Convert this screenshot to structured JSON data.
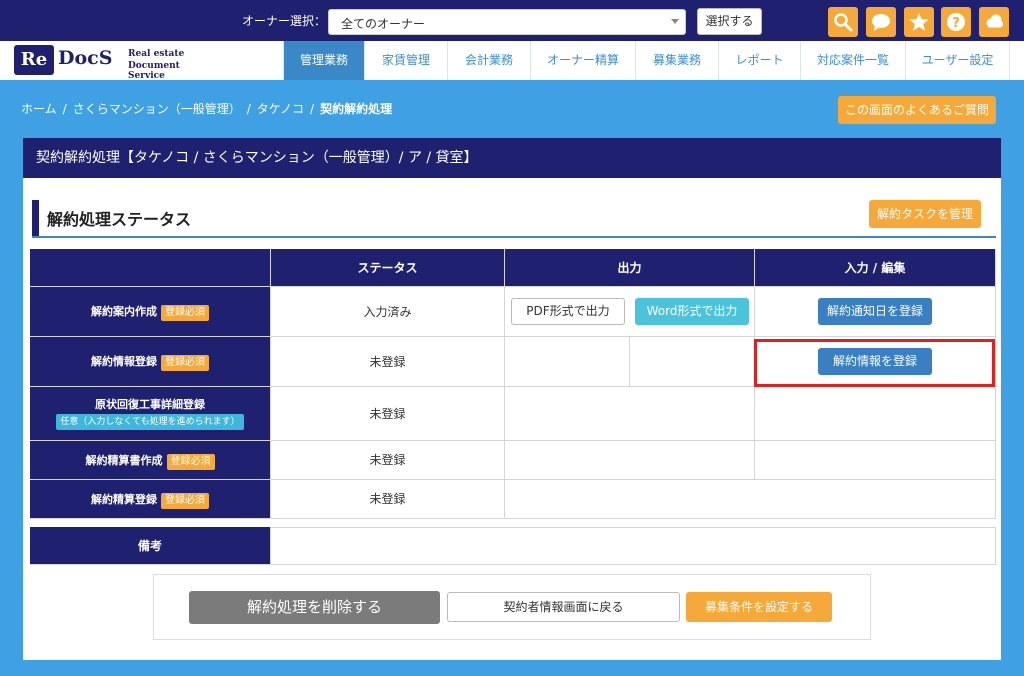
{
  "topbar": {
    "owner_label": "オーナー選択：",
    "owner_value": "全てのオーナー",
    "select_button": "選択する",
    "icons": [
      "search-icon",
      "chat-icon",
      "star-icon",
      "help-icon",
      "cloud-icon"
    ],
    "accent": "#f6a838",
    "bg": "#1f2170"
  },
  "logo": {
    "re": "Re",
    "docs": "DocS",
    "line1": "Real estate",
    "line2": "Document Service"
  },
  "nav": [
    {
      "label": "管理業務",
      "active": true
    },
    {
      "label": "家賃管理"
    },
    {
      "label": "会計業務"
    },
    {
      "label": "オーナー精算"
    },
    {
      "label": "募集業務"
    },
    {
      "label": "レポート"
    },
    {
      "label": "対応案件一覧"
    },
    {
      "label": "ユーザー設定"
    }
  ],
  "breadcrumb": [
    "ホーム",
    "さくらマンション（一般管理）",
    "タケノコ",
    "契約解約処理"
  ],
  "faq_button": "この画面のよくあるご質問",
  "panel": {
    "title": "契約解約処理【タケノコ / さくらマンション（一般管理）/ ア / 貸室】",
    "section_title": "解約処理ステータス",
    "task_button": "解約タスクを管理"
  },
  "table": {
    "headers": {
      "status": "ステータス",
      "output": "出力",
      "edit": "入力 / 編集"
    },
    "rows": [
      {
        "label": "解約案内作成",
        "badge": "登録必須",
        "status": "入力済み",
        "pdf": "PDF形式で出力",
        "word": "Word形式で出力",
        "action": "解約通知日を登録"
      },
      {
        "label": "解約情報登録",
        "badge": "登録必須",
        "status": "未登録",
        "action": "解約情報を登録"
      },
      {
        "label": "原状回復工事詳細登録",
        "optional": "任意（入力しなくても処理を進められます）",
        "status": "未登録"
      },
      {
        "label": "解約精算書作成",
        "badge": "登録必須",
        "status": "未登録"
      },
      {
        "label": "解約精算登録",
        "badge": "登録必須",
        "status": "未登録"
      }
    ],
    "remarks_label": "備考"
  },
  "actions": {
    "delete": "解約処理を削除する",
    "back": "契約者情報画面に戻る",
    "recruit": "募集条件を設定する"
  }
}
